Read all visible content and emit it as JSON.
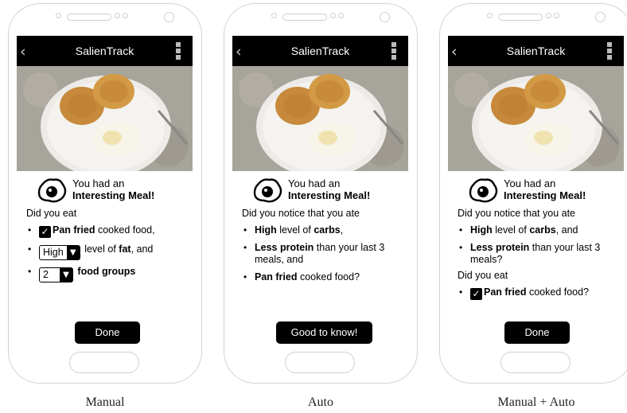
{
  "panels": [
    {
      "app_title": "SalienTrack",
      "headline_line1": "You had an",
      "headline_line2": "Interesting Meal!",
      "question": "Did you eat",
      "items": [
        {
          "bold": "Pan fried",
          "rest": " cooked food,"
        },
        {
          "select_value": "High",
          "pre": " level of ",
          "bold": "fat",
          "rest": ", and"
        },
        {
          "select_value": "2",
          "bold": " food groups"
        }
      ],
      "button": "Done",
      "caption": "Manual"
    },
    {
      "app_title": "SalienTrack",
      "headline_line1": "You had an",
      "headline_line2": "Interesting Meal!",
      "question": "Did you notice that you ate",
      "items": [
        {
          "bold1": "High",
          "mid": " level of ",
          "bold2": "carbs",
          "rest": ","
        },
        {
          "bold1": "Less protein",
          "rest": " than your last 3 meals, and"
        },
        {
          "bold1": "Pan fried",
          "rest": " cooked food?"
        }
      ],
      "button": "Good to know!",
      "caption": "Auto"
    },
    {
      "app_title": "SalienTrack",
      "headline_line1": "You had an",
      "headline_line2": "Interesting Meal!",
      "question": "Did you notice that you ate",
      "items": [
        {
          "bold1": "High",
          "mid": " level of ",
          "bold2": "carbs",
          "rest": ", and"
        },
        {
          "bold1": "Less protein",
          "rest": " than your last 3 meals?"
        }
      ],
      "question2": "Did you eat",
      "items2": [
        {
          "bold": "Pan fried",
          "rest": " cooked food?"
        }
      ],
      "button": "Done",
      "caption": "Manual + Auto"
    }
  ],
  "colors": {
    "appbar": "#000000",
    "button": "#000000",
    "phone_outline": "#d4d4d4"
  },
  "icons": [
    "back-arrow-icon",
    "overflow-menu-icon",
    "fried-egg-icon",
    "checkbox-checked-icon",
    "dropdown-arrow-icon"
  ]
}
